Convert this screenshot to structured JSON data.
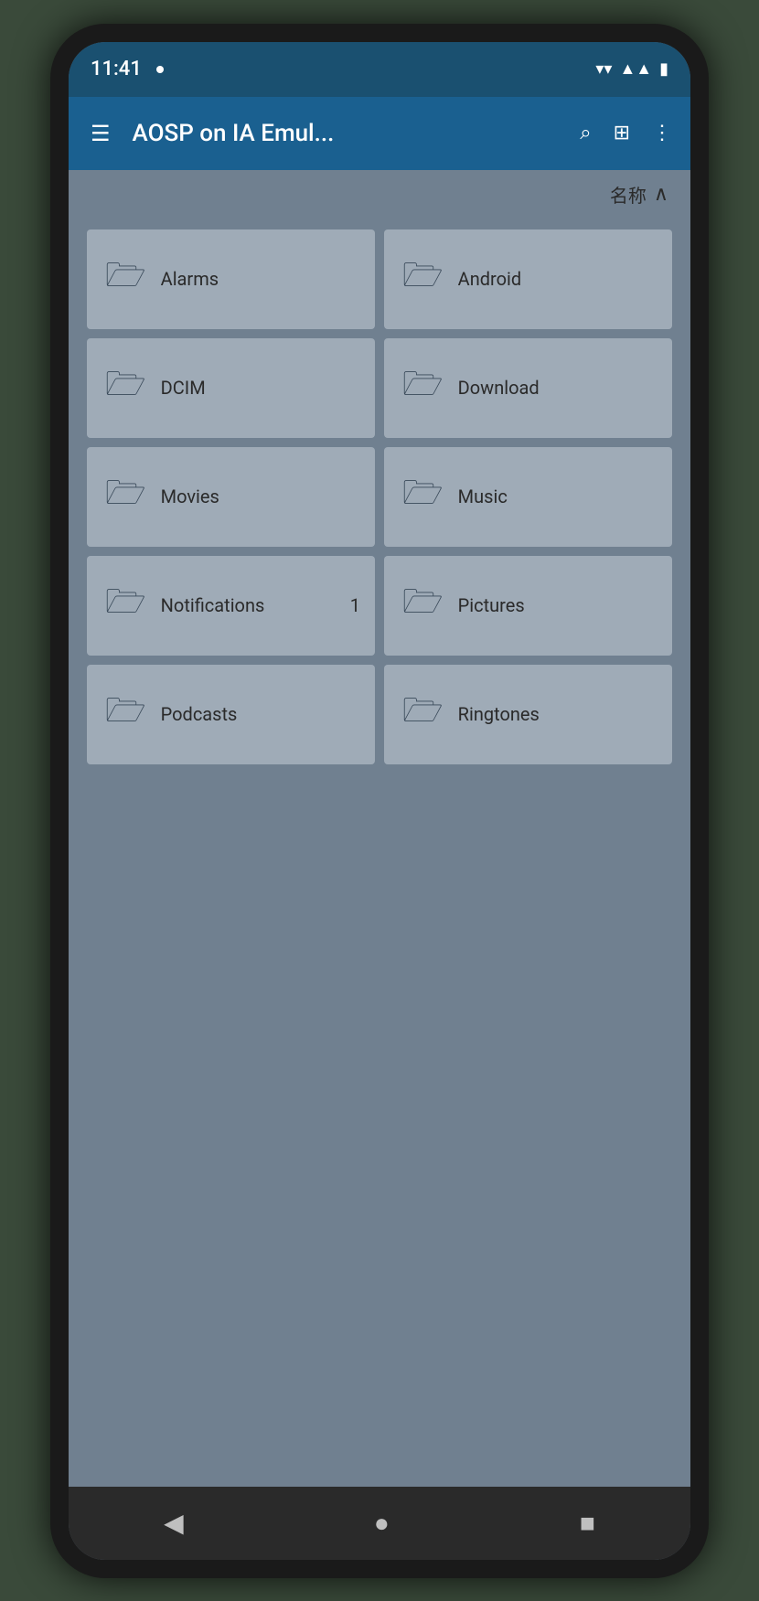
{
  "status": {
    "time": "11:41",
    "dot": "•"
  },
  "topbar": {
    "title": "AOSP on IA Emul...",
    "menu_icon": "☰",
    "search_icon": "⌕",
    "grid_icon": "⊞",
    "more_icon": "⋮"
  },
  "sort": {
    "label": "名称",
    "arrow": "∧"
  },
  "folders": [
    {
      "name": "Alarms",
      "badge": ""
    },
    {
      "name": "Android",
      "badge": ""
    },
    {
      "name": "DCIM",
      "badge": ""
    },
    {
      "name": "Download",
      "badge": ""
    },
    {
      "name": "Movies",
      "badge": ""
    },
    {
      "name": "Music",
      "badge": ""
    },
    {
      "name": "Notifications",
      "badge": "1"
    },
    {
      "name": "Pictures",
      "badge": ""
    },
    {
      "name": "Podcasts",
      "badge": ""
    },
    {
      "name": "Ringtones",
      "badge": ""
    }
  ],
  "nav": {
    "back": "◀",
    "home": "●",
    "recents": "■"
  }
}
